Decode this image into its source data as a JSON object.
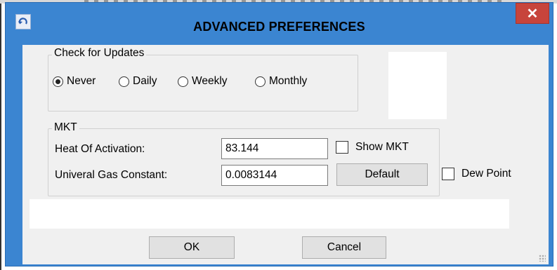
{
  "window": {
    "title": "ADVANCED PREFERENCES",
    "close_glyph": "✕"
  },
  "updates": {
    "label": "Check for Updates",
    "options": [
      "Never",
      "Daily",
      "Weekly",
      "Monthly"
    ],
    "selected": "Never"
  },
  "mkt": {
    "label": "MKT",
    "heat_label": "Heat Of Activation:",
    "heat_value": "83.144",
    "gas_label": "Univeral Gas Constant:",
    "gas_value": "0.0083144",
    "show_mkt_label": "Show MKT",
    "default_label": "Default"
  },
  "dew_point_label": "Dew Point",
  "buttons": {
    "ok": "OK",
    "cancel": "Cancel"
  },
  "colors": {
    "titlebar": "#3b85d1",
    "close": "#c7443b",
    "client": "#f0f0f0"
  },
  "icons": {
    "app": "refresh-arrow-icon",
    "close": "close-icon"
  }
}
